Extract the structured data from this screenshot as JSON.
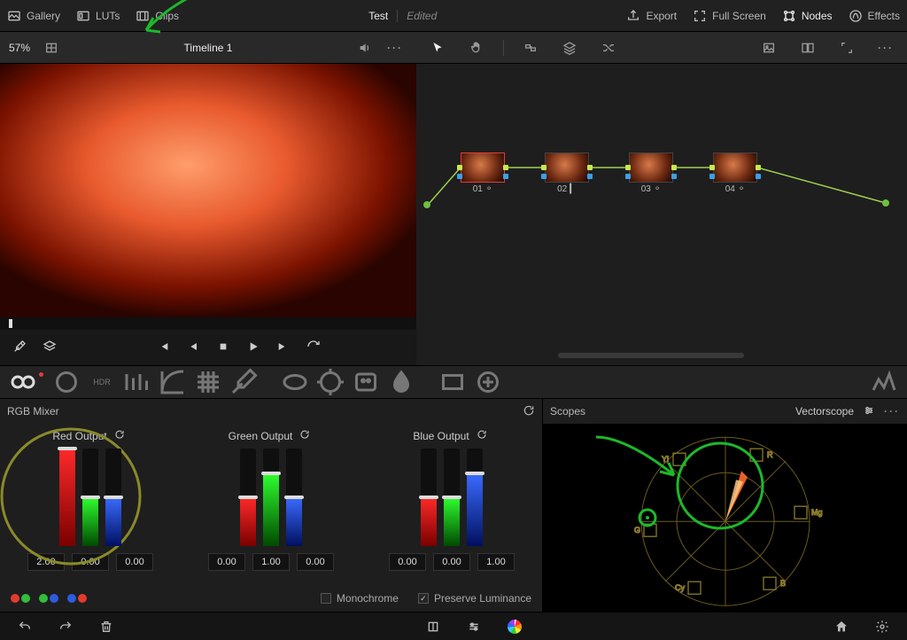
{
  "topbar": {
    "gallery": "Gallery",
    "luts": "LUTs",
    "clips": "Clips",
    "project": "Test",
    "edited": "Edited",
    "export": "Export",
    "fullscreen": "Full Screen",
    "nodes": "Nodes",
    "effects": "Effects"
  },
  "viewer": {
    "zoom": "57%",
    "timeline_name": "Timeline 1"
  },
  "nodes": [
    {
      "id": "01",
      "selected": true
    },
    {
      "id": "02",
      "selected": false
    },
    {
      "id": "03",
      "selected": false
    },
    {
      "id": "04",
      "selected": false
    }
  ],
  "rgb": {
    "panel_title": "RGB Mixer",
    "monochrome": "Monochrome",
    "preserve_luminance": "Preserve Luminance",
    "preserve_luminance_checked": true,
    "outputs": {
      "red": {
        "label": "Red Output",
        "values": [
          "2.00",
          "0.00",
          "0.00"
        ],
        "fills": [
          100,
          50,
          50
        ]
      },
      "green": {
        "label": "Green Output",
        "values": [
          "0.00",
          "1.00",
          "0.00"
        ],
        "fills": [
          50,
          75,
          50
        ]
      },
      "blue": {
        "label": "Blue Output",
        "values": [
          "0.00",
          "0.00",
          "1.00"
        ],
        "fills": [
          50,
          50,
          75
        ]
      }
    }
  },
  "scopes": {
    "panel_title": "Scopes",
    "mode": "Vectorscope",
    "targets": [
      "R",
      "Mg",
      "B",
      "Cy",
      "G",
      "Yl"
    ]
  },
  "colors": {
    "red": "#e23b2e",
    "green": "#2fbf3a",
    "blue": "#2e5be2"
  }
}
